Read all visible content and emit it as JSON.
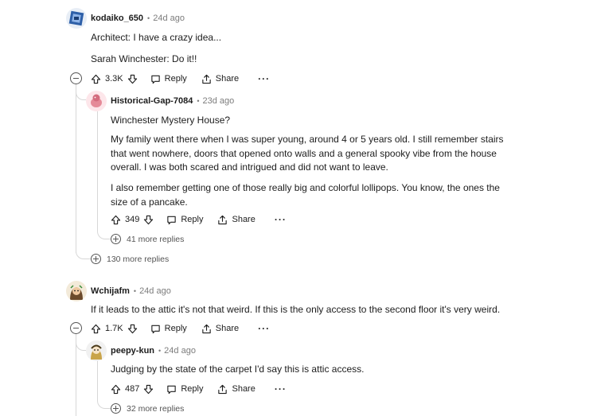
{
  "comments": [
    {
      "user": "kodaiko_650",
      "time": "24d ago",
      "body": [
        "Architect: I have a crazy idea...",
        "Sarah Winchester: Do it!!"
      ],
      "votes": "3.3K"
    },
    {
      "user": "Historical-Gap-7084",
      "time": "23d ago",
      "body": [
        "Winchester Mystery House?",
        "My family went there when I was super young, around 4 or 5 years old. I still remember stairs that went nowhere, doors that opened onto walls and a general spooky vibe from the house overall. I was both scared and intrigued and did not want to leave.",
        "I also remember getting one of those really big and colorful lollipops. You know, the ones the size of a pancake."
      ],
      "votes": "349",
      "more_replies": "41 more replies"
    },
    {
      "thread_more_replies": "130 more replies"
    },
    {
      "user": "Wchijafm",
      "time": "24d ago",
      "body": [
        "If it leads to the attic it's not that weird. If this is the only access to the second floor it's very weird."
      ],
      "votes": "1.7K"
    },
    {
      "user": "peepy-kun",
      "time": "24d ago",
      "body": [
        "Judging by the state of the carpet I'd say this is attic access."
      ],
      "votes": "487",
      "more_replies": "32 more replies"
    }
  ],
  "actions": {
    "reply": "Reply",
    "share": "Share",
    "more": "···"
  },
  "colors": {
    "text": "#1c1c1c",
    "muted": "#7c7c7c",
    "thread_line": "#d7d7d7"
  }
}
